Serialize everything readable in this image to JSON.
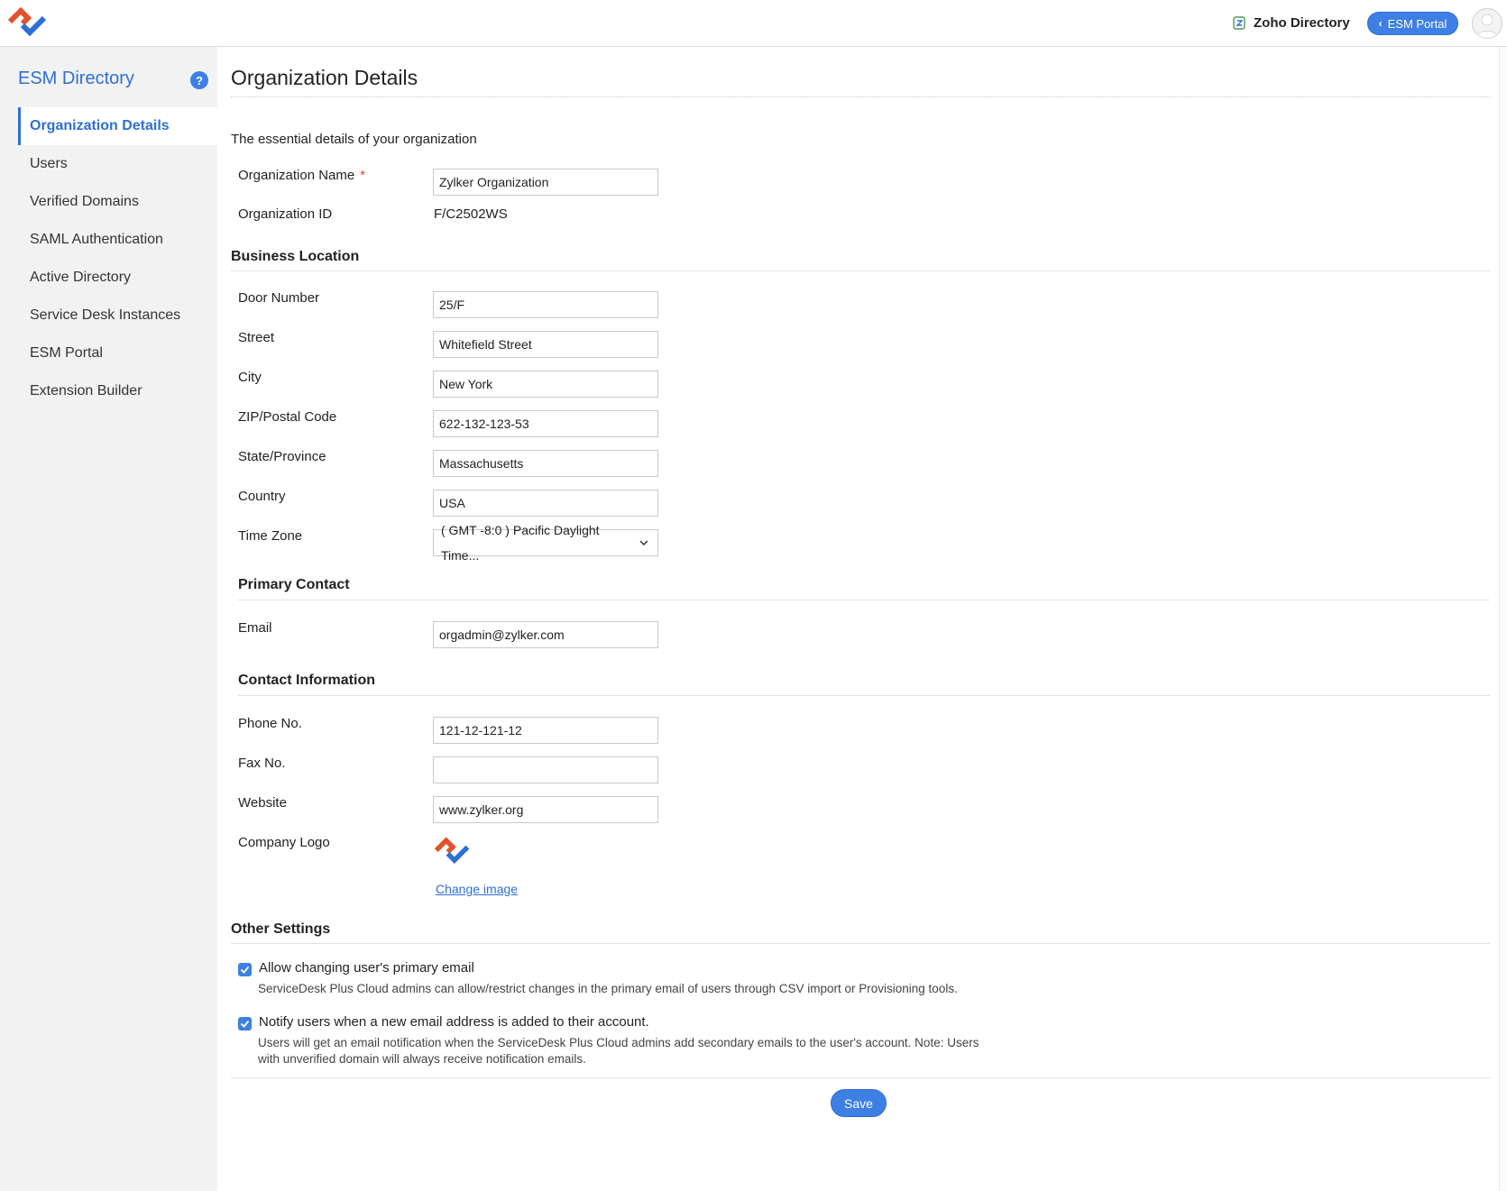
{
  "header": {
    "app_name": "Zoho Directory",
    "back_button_label": "ESM Portal"
  },
  "sidebar": {
    "title": "ESM Directory",
    "help_label": "?",
    "items": [
      {
        "label": "Organization Details",
        "active": true
      },
      {
        "label": "Users"
      },
      {
        "label": "Verified Domains"
      },
      {
        "label": "SAML Authentication"
      },
      {
        "label": "Active Directory"
      },
      {
        "label": "Service Desk Instances"
      },
      {
        "label": "ESM Portal"
      },
      {
        "label": "Extension Builder"
      }
    ]
  },
  "page": {
    "title": "Organization Details",
    "intro": "The essential details of your organization"
  },
  "org": {
    "name_label": "Organization Name",
    "required_mark": "*",
    "name_value": "Zylker Organization",
    "id_label": "Organization ID",
    "id_value": "F/C2502WS"
  },
  "business_location": {
    "title": "Business Location",
    "door_label": "Door Number",
    "door_value": "25/F",
    "street_label": "Street",
    "street_value": "Whitefield Street",
    "city_label": "City",
    "city_value": "New York",
    "zip_label": "ZIP/Postal Code",
    "zip_value": "622-132-123-53",
    "state_label": "State/Province",
    "state_value": "Massachusetts",
    "country_label": "Country",
    "country_value": "USA",
    "timezone_label": "Time Zone",
    "timezone_value": "( GMT -8:0 ) Pacific Daylight Time..."
  },
  "primary_contact": {
    "title": "Primary Contact",
    "email_label": "Email",
    "email_value": "orgadmin@zylker.com"
  },
  "contact_info": {
    "title": "Contact Information",
    "phone_label": "Phone No.",
    "phone_value": "121-12-121-12",
    "fax_label": "Fax No.",
    "fax_value": "",
    "website_label": "Website",
    "website_value": "www.zylker.org",
    "logo_label": "Company Logo",
    "change_image_label": "Change image"
  },
  "other_settings": {
    "title": "Other Settings",
    "allow_change_label": "Allow changing user's primary email",
    "allow_change_checked": true,
    "allow_change_desc": "ServiceDesk Plus Cloud admins can allow/restrict changes in the primary email of users through CSV import or Provisioning tools.",
    "notify_label": "Notify users when a new email address is added to their account.",
    "notify_checked": true,
    "notify_desc_line1": "Users will get an email notification when the ServiceDesk Plus Cloud admins add secondary emails to the user's account. Note: Users",
    "notify_desc_line2": "with unverified domain will always receive notification emails."
  },
  "actions": {
    "save_label": "Save"
  },
  "colors": {
    "accent": "#3d7fe4",
    "link": "#2e6fd6",
    "logo_orange": "#e2532d",
    "logo_blue": "#2e6fd6",
    "required": "#e0463b"
  }
}
